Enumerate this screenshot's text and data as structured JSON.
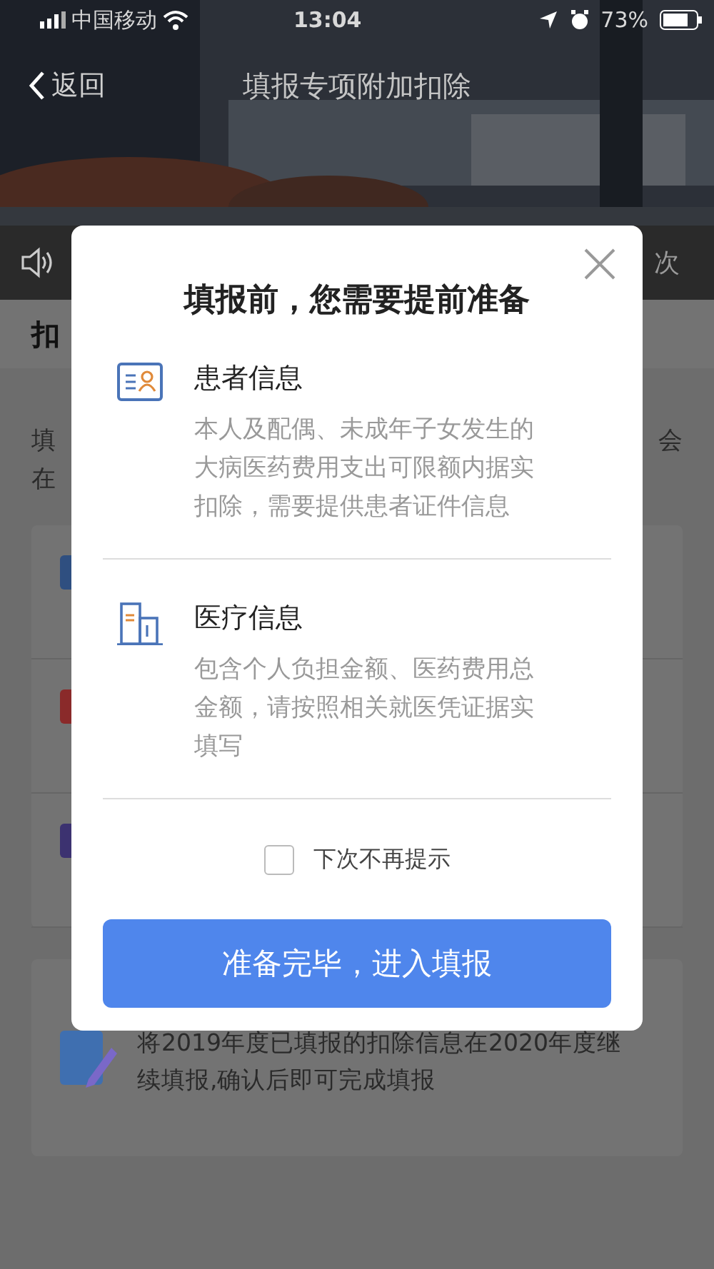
{
  "status_bar": {
    "carrier": "中国移动",
    "time": "13:04",
    "battery": "73%"
  },
  "nav_bar": {
    "back": "返回",
    "title": "填报专项附加扣除"
  },
  "background": {
    "notice_fragment": "次",
    "section_fragment": "扣",
    "intro_left": [
      "填",
      "在"
    ],
    "intro_right": "会",
    "cards": [
      {
        "color": "#2f4f80"
      },
      {
        "color": "#8a2a2a"
      },
      {
        "color": "#3c3270"
      }
    ],
    "bottom_card": {
      "description": "将2019年度已填报的扣除信息在2020年度继续填报,确认后即可完成填报"
    }
  },
  "dialog": {
    "title": "填报前，您需要提前准备",
    "items": [
      {
        "kind": "patient",
        "title": "患者信息",
        "description": "本人及配偶、未成年子女发生的大病医药费用支出可限额内据实扣除，需要提供患者证件信息"
      },
      {
        "kind": "medical",
        "title": "医疗信息",
        "description": "包含个人负担金额、医药费用总金额，请按照相关就医凭证据实填写"
      }
    ],
    "dont_show_again": {
      "label": "下次不再提示",
      "checked": false
    },
    "confirm_button": "准备完毕，进入填报"
  }
}
